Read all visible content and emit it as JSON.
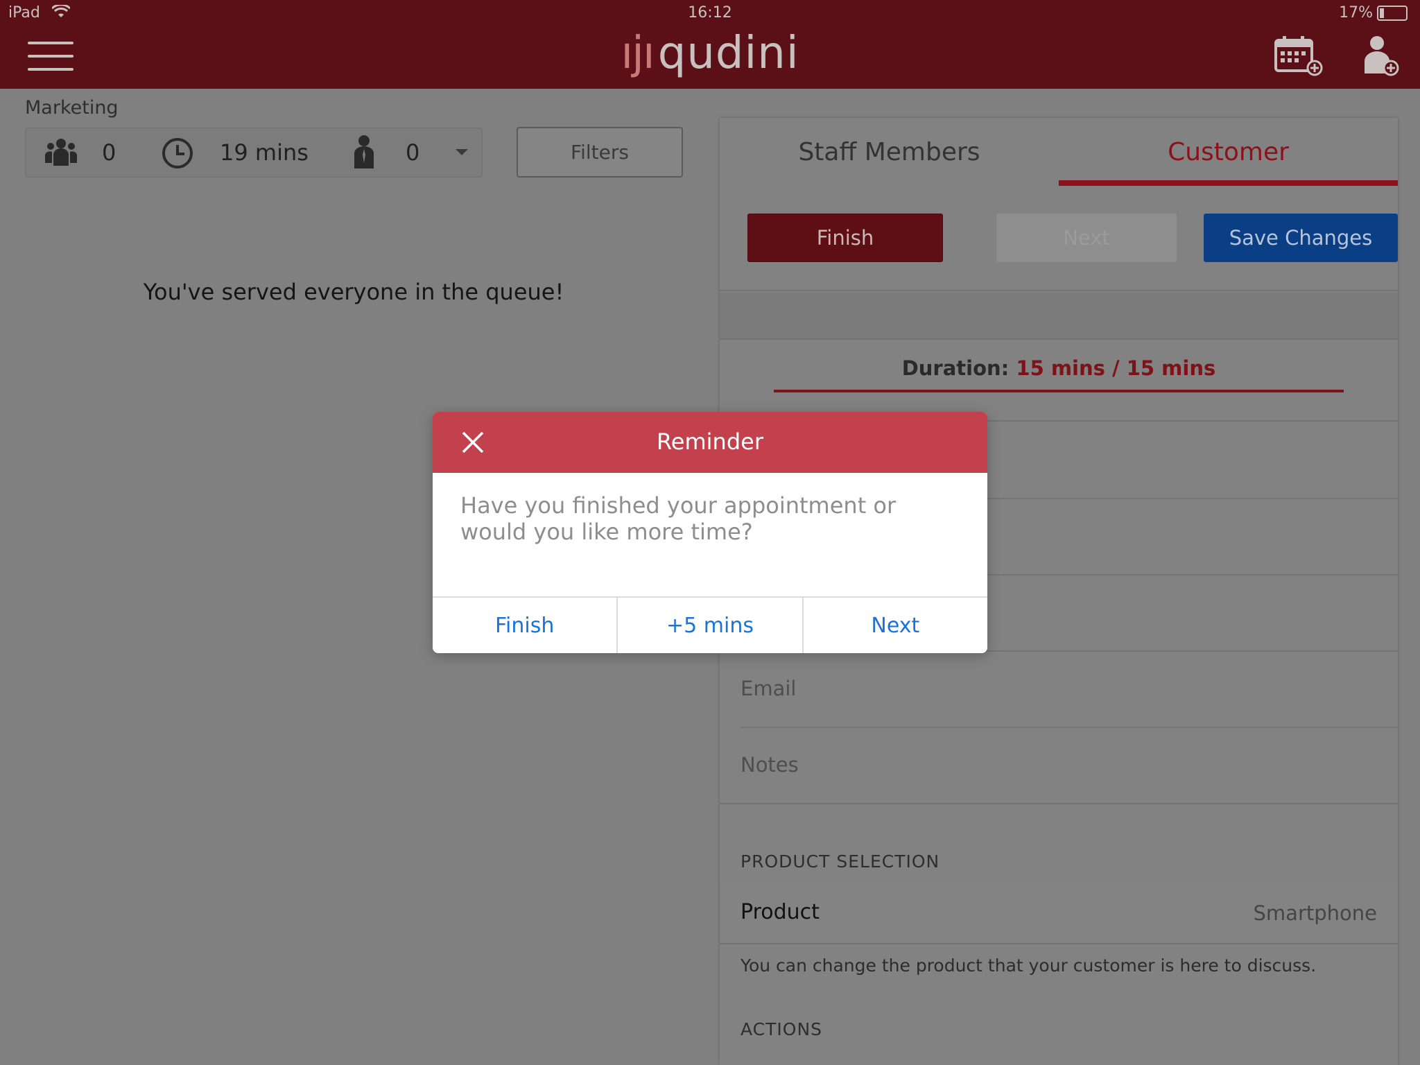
{
  "status_bar": {
    "device": "iPad",
    "time": "16:12",
    "battery": "17%"
  },
  "header": {
    "logo_mark": "ıjı",
    "logo_text": "qudini"
  },
  "left": {
    "section_label": "Marketing",
    "stats": {
      "customers": "0",
      "wait_time": "19 mins",
      "staff": "0"
    },
    "filters_label": "Filters",
    "empty_message": "You've served everyone in the queue!"
  },
  "right": {
    "tabs": [
      {
        "label": "Staff Members"
      },
      {
        "label": "Customer"
      }
    ],
    "buttons": {
      "finish": "Finish",
      "next": "Next",
      "save": "Save Changes"
    },
    "duration": {
      "label": "Duration:",
      "elapsed": "15 mins",
      "separator": "/",
      "total": "15 mins"
    },
    "fields": {
      "email": "Email",
      "notes": "Notes"
    },
    "product_section": "PRODUCT SELECTION",
    "product": {
      "label": "Product",
      "value": "Smartphone"
    },
    "product_helper": "You can change the product that your customer is here to discuss.",
    "actions_section": "ACTIONS"
  },
  "modal": {
    "title": "Reminder",
    "body": "Have you finished your appointment or would you like more time?",
    "buttons": {
      "finish": "Finish",
      "extend": "+5 mins",
      "next": "Next"
    }
  },
  "colors": {
    "header_bg": "#5b0f16",
    "accent_red": "#8c1119",
    "modal_header": "#c2414c",
    "save_blue": "#0b3f85",
    "link_blue": "#1a73d9"
  }
}
